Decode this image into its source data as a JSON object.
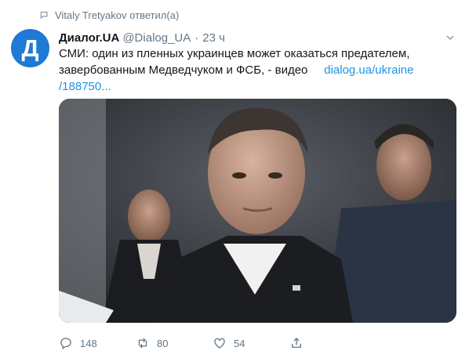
{
  "retweet_context": {
    "text": "Vitaly Tretyakov ответил(а)",
    "icon": "reply-context-icon"
  },
  "tweet": {
    "avatar_letter": "Д",
    "author_name": "Диалог.UA",
    "author_handle": "@Dialog_UA",
    "separator": "·",
    "time": "23 ч",
    "text_line1": "СМИ: один из пленных украинцев может оказаться предателем,",
    "text_line2": "завербованным Медведчуком и ФСБ, - видео",
    "link_line1": "dialog.ua/ukraine",
    "link_line2": "/188750..."
  },
  "actions": {
    "reply_count": "148",
    "retweet_count": "80",
    "like_count": "54"
  },
  "colors": {
    "accent": "#1b95e0",
    "muted": "#657786",
    "avatar_bg": "#1f7ad6"
  }
}
